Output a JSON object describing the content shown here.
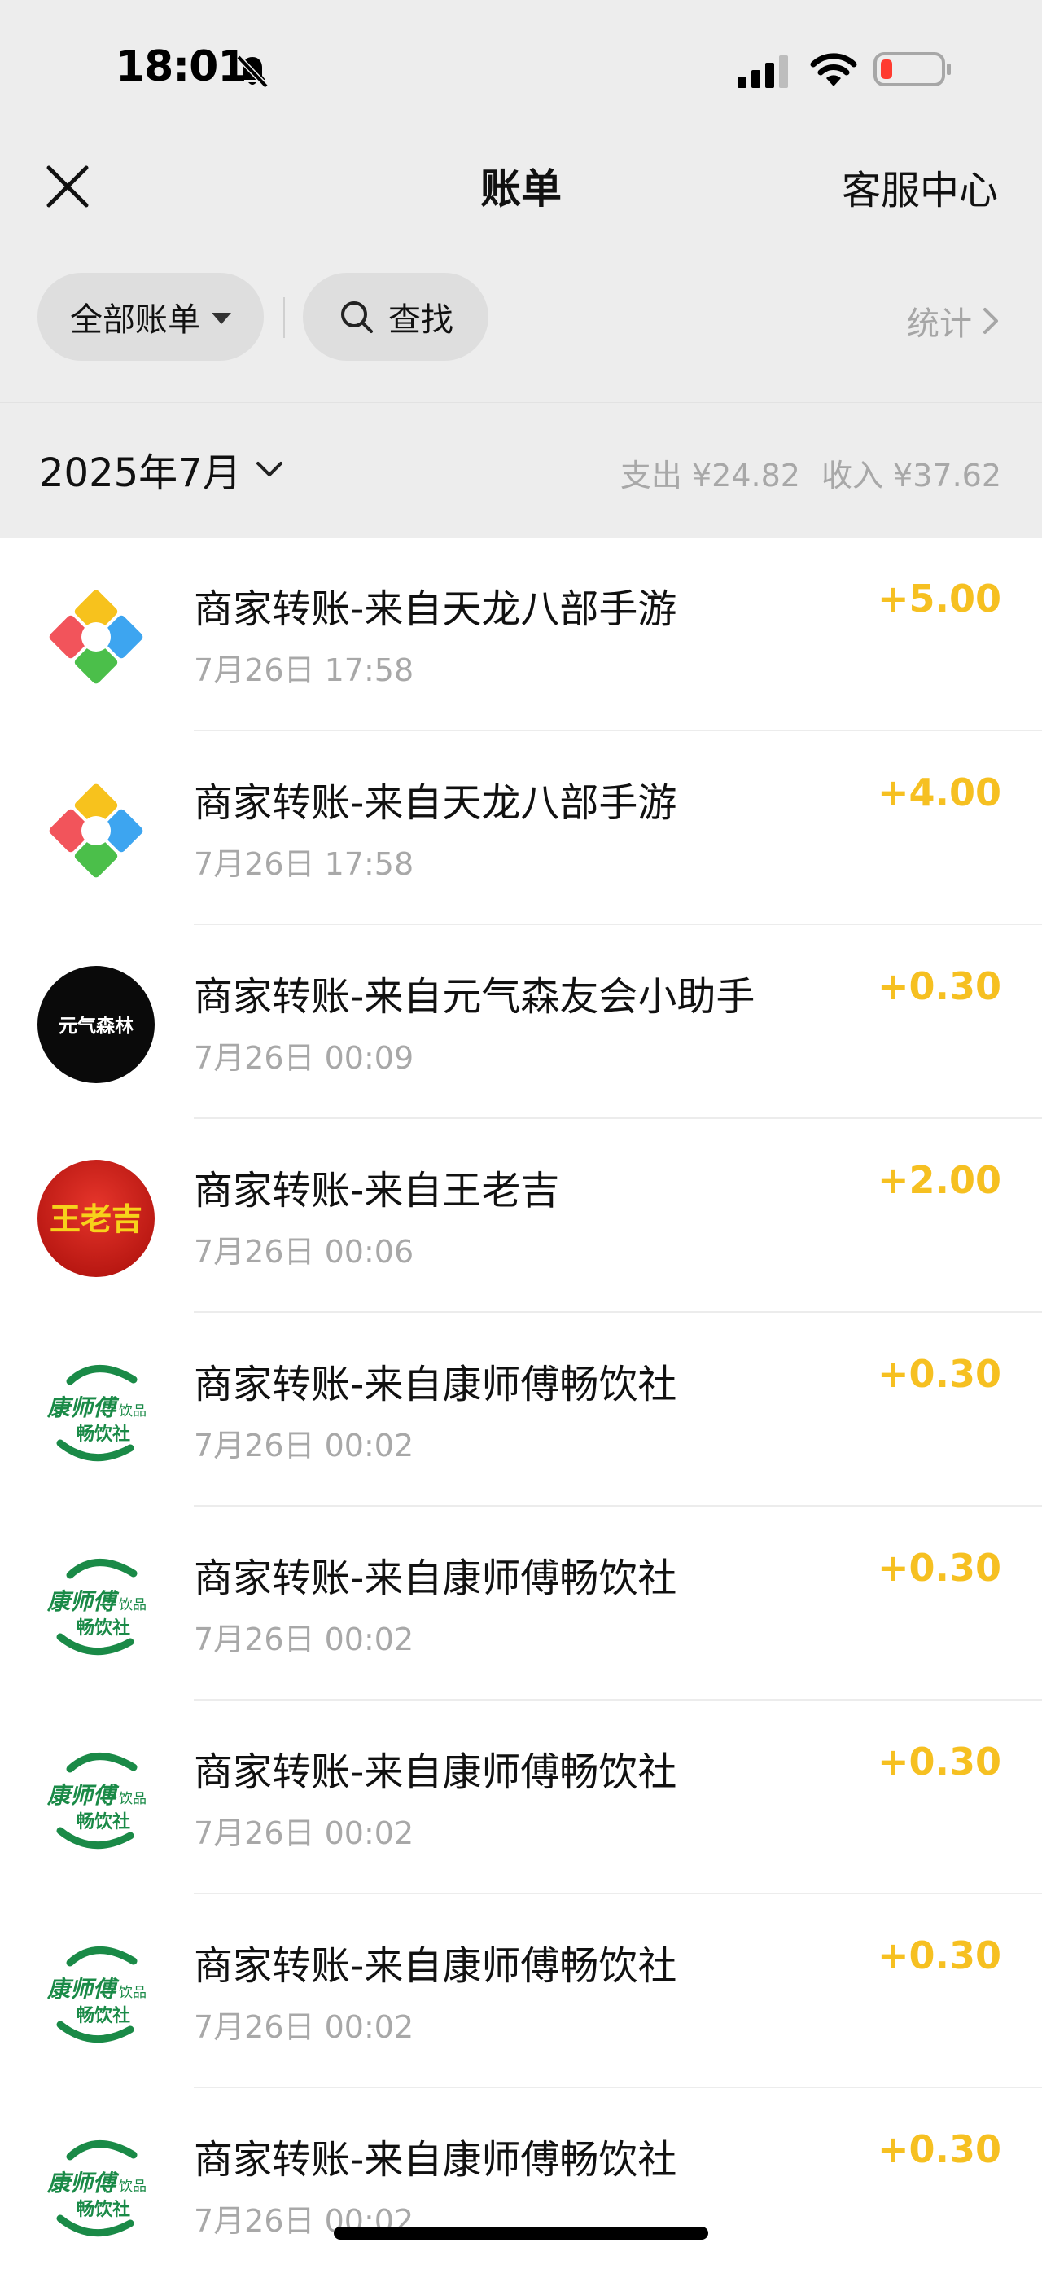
{
  "status_bar": {
    "time": "18:01",
    "icons": [
      "bell-slash-icon",
      "cellular-signal-icon",
      "wifi-icon",
      "battery-low-icon"
    ],
    "battery_color": "#ff3b30"
  },
  "nav": {
    "close_icon": "close-icon",
    "title": "账单",
    "service_center": "客服中心"
  },
  "filters": {
    "all_bills": "全部账单",
    "search": "查找",
    "stats": "统计"
  },
  "month": {
    "label": "2025年7月",
    "expense": "支出 ¥24.82",
    "income": "收入 ¥37.62"
  },
  "colors": {
    "income_amount": "#f6c021",
    "background_top": "#ededed",
    "secondary_text": "#a8a8a8"
  },
  "bills": [
    {
      "title": "商家转账-来自天龙八部手游",
      "time": "7月26日 17:58",
      "amount": "+5.00",
      "avatar": "tianlong-logo-icon"
    },
    {
      "title": "商家转账-来自天龙八部手游",
      "time": "7月26日 17:58",
      "amount": "+4.00",
      "avatar": "tianlong-logo-icon"
    },
    {
      "title": "商家转账-来自元气森友会小助手",
      "time": "7月26日 00:09",
      "amount": "+0.30",
      "avatar": "genki-forest-logo-icon",
      "avatar_text": "元气森林"
    },
    {
      "title": "商家转账-来自王老吉",
      "time": "7月26日 00:06",
      "amount": "+2.00",
      "avatar": "wanglaoji-logo-icon",
      "avatar_text": "王老吉"
    },
    {
      "title": "商家转账-来自康师傅畅饮社",
      "time": "7月26日 00:02",
      "amount": "+0.30",
      "avatar": "master-kong-logo-icon",
      "avatar_text": [
        "康师傅",
        "饮品",
        "畅饮社"
      ]
    },
    {
      "title": "商家转账-来自康师傅畅饮社",
      "time": "7月26日 00:02",
      "amount": "+0.30",
      "avatar": "master-kong-logo-icon",
      "avatar_text": [
        "康师傅",
        "饮品",
        "畅饮社"
      ]
    },
    {
      "title": "商家转账-来自康师傅畅饮社",
      "time": "7月26日 00:02",
      "amount": "+0.30",
      "avatar": "master-kong-logo-icon",
      "avatar_text": [
        "康师傅",
        "饮品",
        "畅饮社"
      ]
    },
    {
      "title": "商家转账-来自康师傅畅饮社",
      "time": "7月26日 00:02",
      "amount": "+0.30",
      "avatar": "master-kong-logo-icon",
      "avatar_text": [
        "康师傅",
        "饮品",
        "畅饮社"
      ]
    },
    {
      "title": "商家转账-来自康师傅畅饮社",
      "time": "7月26日 00:02",
      "amount": "+0.30",
      "avatar": "master-kong-logo-icon",
      "avatar_text": [
        "康师傅",
        "饮品",
        "畅饮社"
      ]
    }
  ]
}
